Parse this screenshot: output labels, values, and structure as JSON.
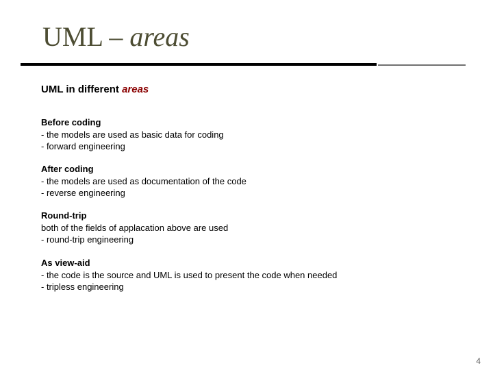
{
  "title": {
    "prefix": "UML – ",
    "italic_word": "areas"
  },
  "subtitle": {
    "prefix": "UML in different ",
    "areas_word": "areas"
  },
  "sections": {
    "s1": {
      "head": "Before coding",
      "l1": "- the models are used as basic data for coding",
      "l2": "- forward engineering"
    },
    "s2": {
      "head": "After coding",
      "l1": "- the models are used as documentation of the code",
      "l2": "- reverse engineering"
    },
    "s3": {
      "head": "Round-trip",
      "l1": "  both of the fields of applacation above are used",
      "l2": "  - round-trip engineering"
    },
    "s4": {
      "head": "As view-aid",
      "l1": "- the code is the source and UML is used to present the code when needed",
      "l2": "- tripless engineering"
    }
  },
  "page_number": "4"
}
